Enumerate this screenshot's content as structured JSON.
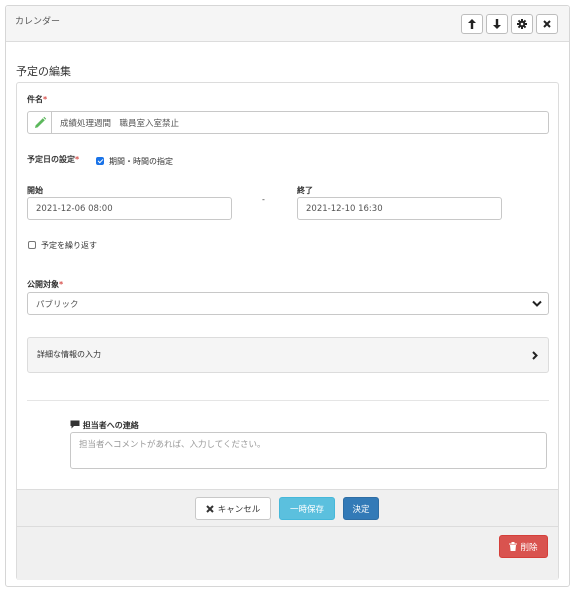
{
  "header": {
    "title": "カレンダー",
    "buttons": [
      "arrow-up-icon",
      "arrow-down-icon",
      "gear-icon",
      "close-icon"
    ]
  },
  "page_title": "予定の編集",
  "form": {
    "subject": {
      "label": "件名",
      "required_mark": "*",
      "value": "成績処理週間　職員室入室禁止"
    },
    "date_setting": {
      "label": "予定日の設定",
      "required_mark": "*",
      "checkbox_label": "期間・時間の指定",
      "checked": true
    },
    "start": {
      "label": "開始",
      "value": "2021-12-06 08:00"
    },
    "separator": "-",
    "end": {
      "label": "終了",
      "value": "2021-12-10 16:30"
    },
    "repeat": {
      "label": "予定を繰り返す",
      "checked": false
    },
    "visibility": {
      "label": "公開対象",
      "required_mark": "*",
      "selected": "パブリック"
    },
    "details": {
      "label": "詳細な情報の入力"
    },
    "contact": {
      "label": "担当者への連絡",
      "placeholder": "担当者へコメントがあれば、入力してください。"
    }
  },
  "footer": {
    "cancel_label": "キャンセル",
    "temp_save_label": "一時保存",
    "submit_label": "決定",
    "delete_label": "削除"
  },
  "colors": {
    "primary": "#337ab7",
    "info": "#5bc0de",
    "danger": "#d9534f",
    "required": "#d9534f",
    "pencil": "#5cb85c"
  }
}
